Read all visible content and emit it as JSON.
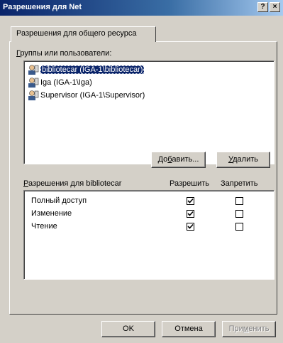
{
  "window": {
    "title": "Разрешения для Net",
    "help_label": "?",
    "close_label": "×"
  },
  "tab": {
    "label": "Разрешения для общего ресурса"
  },
  "groups": {
    "label_first": "Г",
    "label_rest": "руппы или пользователи:",
    "items": [
      {
        "name": "bibliotecar (IGA-1\\bibliotecar)",
        "selected": true,
        "icon": "user-icon"
      },
      {
        "name": "Iga (IGA-1\\Iga)",
        "selected": false,
        "icon": "user-icon"
      },
      {
        "name": "Supervisor (IGA-1\\Supervisor)",
        "selected": false,
        "icon": "user-icon"
      }
    ]
  },
  "buttons": {
    "add_first": "До",
    "add_u": "б",
    "add_rest": "авить...",
    "remove_u": "У",
    "remove_rest": "далить",
    "ok": "OK",
    "cancel": "Отмена",
    "apply_first": "При",
    "apply_u": "м",
    "apply_rest": "енить"
  },
  "permissions": {
    "label_u": "Р",
    "label_rest": "азрешения для bibliotecar",
    "allow_header": "Разрешить",
    "deny_header": "Запретить",
    "rows": [
      {
        "name": "Полный доступ",
        "allow": true,
        "deny": false
      },
      {
        "name": "Изменение",
        "allow": true,
        "deny": false
      },
      {
        "name": "Чтение",
        "allow": true,
        "deny": false
      }
    ]
  },
  "colors": {
    "titlebar_start": "#0a246a",
    "titlebar_end": "#a6caf0",
    "face": "#d4d0c8",
    "selection": "#0a246a"
  }
}
